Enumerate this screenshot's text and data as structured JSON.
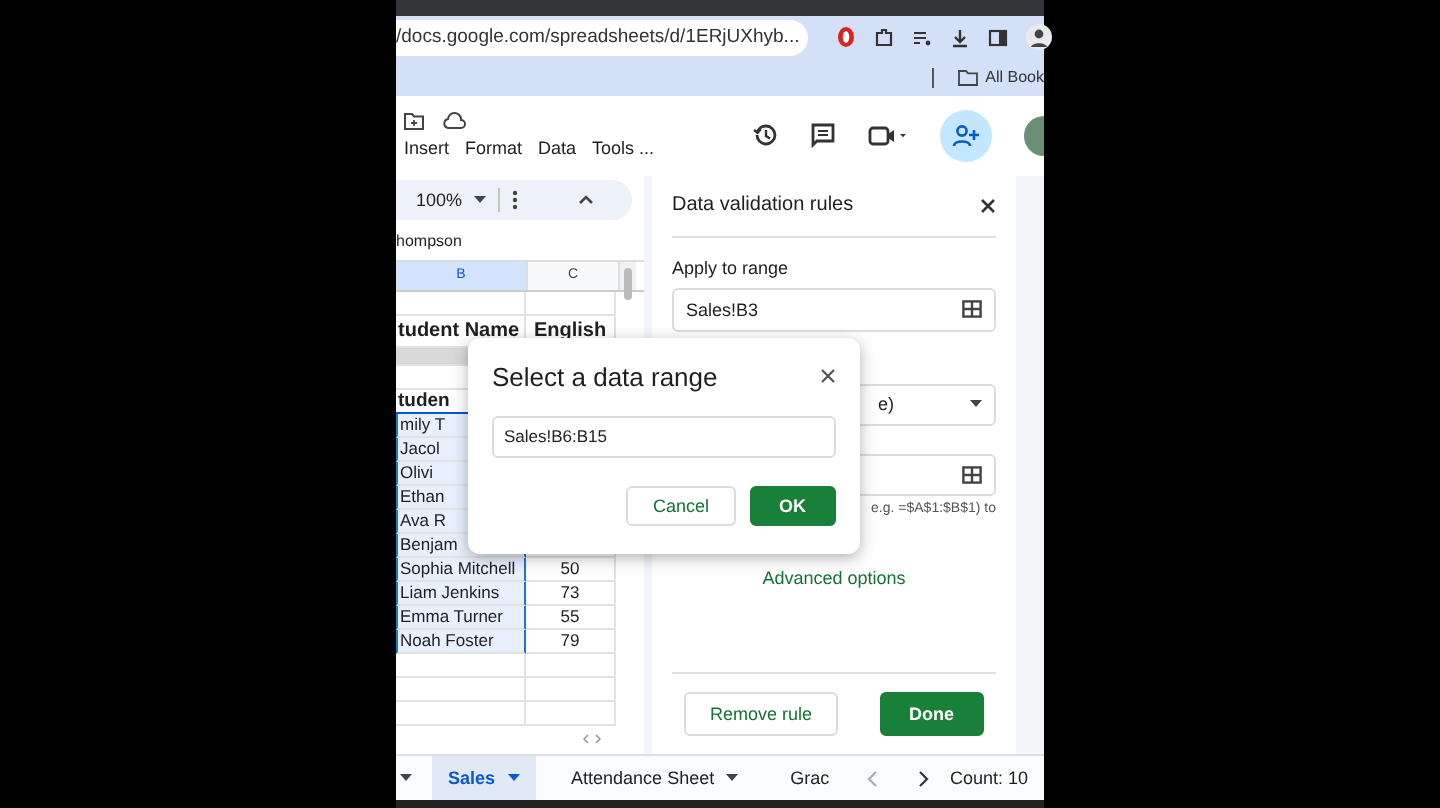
{
  "browser": {
    "url": "/docs.google.com/spreadsheets/d/1ERjUXhyb...",
    "bookmarks": "All Book"
  },
  "menu": [
    "Insert",
    "Format",
    "Data",
    "Tools ..."
  ],
  "toolbar": {
    "zoom": "100%"
  },
  "name_box": "hompson",
  "sheet": {
    "columns": [
      {
        "label": "B",
        "selected": true
      },
      {
        "label": "C",
        "selected": false
      }
    ],
    "rows": [
      {
        "kind": "blank"
      },
      {
        "kind": "heading",
        "cells": [
          "tudent Name",
          "English"
        ]
      },
      {
        "kind": "band"
      },
      {
        "kind": "blank"
      },
      {
        "kind": "subheading",
        "cells": [
          "tuden"
        ],
        "selected": false
      },
      {
        "kind": "data",
        "cells": [
          "mily T"
        ],
        "selected": true
      },
      {
        "kind": "data",
        "cells": [
          "Jacol"
        ],
        "selected": true
      },
      {
        "kind": "data",
        "cells": [
          "Olivi"
        ],
        "selected": true
      },
      {
        "kind": "data",
        "cells": [
          "Ethan"
        ],
        "selected": true
      },
      {
        "kind": "data",
        "cells": [
          "Ava R"
        ],
        "selected": true
      },
      {
        "kind": "data",
        "cells": [
          "Benjam"
        ],
        "selected": true
      },
      {
        "kind": "data",
        "cells": [
          "Sophia Mitchell",
          "50"
        ],
        "selected": true
      },
      {
        "kind": "data",
        "cells": [
          "Liam Jenkins",
          "73"
        ],
        "selected": true
      },
      {
        "kind": "data",
        "cells": [
          "Emma Turner",
          "55"
        ],
        "selected": true
      },
      {
        "kind": "data",
        "cells": [
          "Noah Foster",
          "79"
        ],
        "selected": true
      },
      {
        "kind": "blank"
      },
      {
        "kind": "blank"
      },
      {
        "kind": "blank"
      }
    ]
  },
  "panel": {
    "title": "Data validation rules",
    "apply_label": "Apply to range",
    "range": "Sales!B3",
    "criteria": "e)",
    "help": "e.g. =$A$1:$B$1) to",
    "advanced": "Advanced options",
    "buttons": [
      "Remove rule",
      "Done"
    ]
  },
  "dialog": {
    "title": "Select a data range",
    "value": "Sales!B6:B15",
    "buttons": [
      "Cancel",
      "OK"
    ]
  },
  "sheet_tabs": [
    {
      "label": "Sales",
      "selected": true,
      "menu": true
    },
    {
      "label": "Attendance Sheet",
      "selected": false,
      "menu": true
    },
    {
      "label": "Grac",
      "selected": false,
      "menu": false
    }
  ],
  "status": "Count: 10"
}
